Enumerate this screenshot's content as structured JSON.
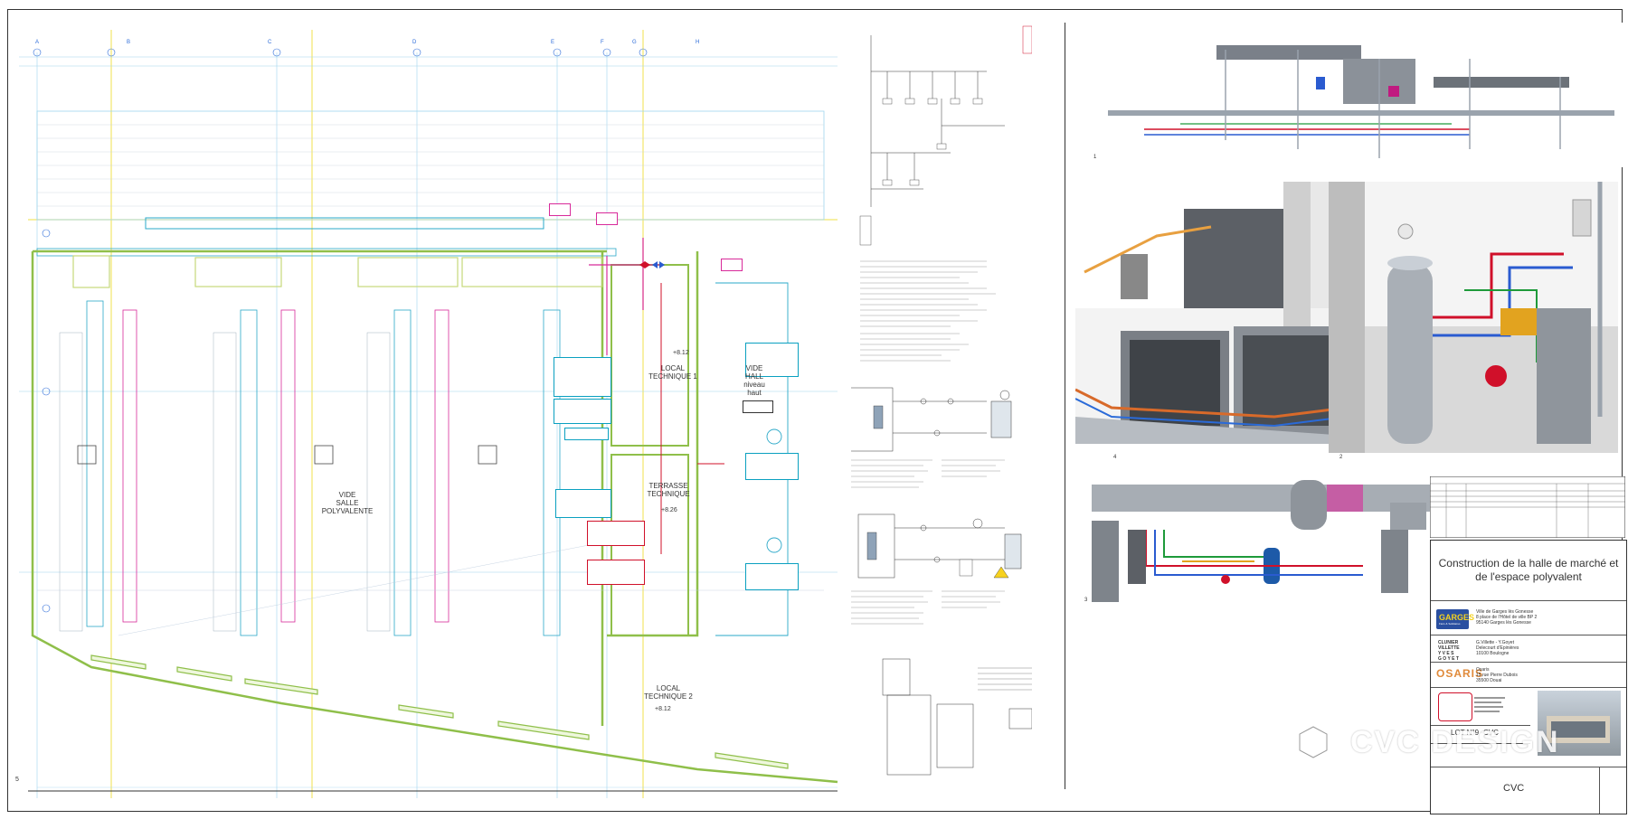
{
  "sheet": {
    "rooms": [
      {
        "id": "salle",
        "label": "VIDE\nSALLE\nPOLYVALENTE"
      },
      {
        "id": "local1",
        "label": "LOCAL\nTECHNIQUE 1"
      },
      {
        "id": "vide_hall",
        "label": "VIDE\nHALL\nniveau\nhaut"
      },
      {
        "id": "terrasse",
        "label": "TERRASSE\nTECHNIQUE"
      },
      {
        "id": "local2",
        "label": "LOCAL\nTECHNIQUE 2"
      }
    ],
    "levels": [
      "+8.12",
      "+8.26",
      "+8.12"
    ],
    "grid_axes": [
      "A",
      "B",
      "C",
      "D",
      "E",
      "F",
      "G",
      "H"
    ]
  },
  "views": {
    "view1_label": "1",
    "view2_label": "2",
    "view3_label": "3",
    "view4_label": "4",
    "view5_label": "5"
  },
  "titleblock": {
    "project_title": "Construction de la halle de marché et de l'espace polyvalent",
    "client_name": "GARGES",
    "client_sub": "Fiers & Solidaires",
    "client_address": "Ville de Garges lès Gonesse\n8 place de l'Hôtel de ville BP 2\n95140 Garges lès Gonesse",
    "architect_names": "CLUNIER\nVILLETTE\nY V E S\nG O Y E T",
    "architect_address": "G.Villette - Y.Goyet\nDelecourt d'Epinières\n10100 Boulogne",
    "engineer_name": "OSARIS",
    "engineer_address": "Osaris\n15,rue Pierre Dubois\n35500 Douai",
    "lot_label": "LOT N°9 -CVC",
    "discipline": "CVC"
  },
  "watermark": {
    "text": "CVC DESIGN"
  },
  "colors": {
    "grid": "#f2e76a",
    "duct_cyan": "#2aa8c8",
    "duct_magenta": "#d82a9a",
    "wall_green": "#8fbf4a",
    "pipe_red": "#d0102a"
  }
}
